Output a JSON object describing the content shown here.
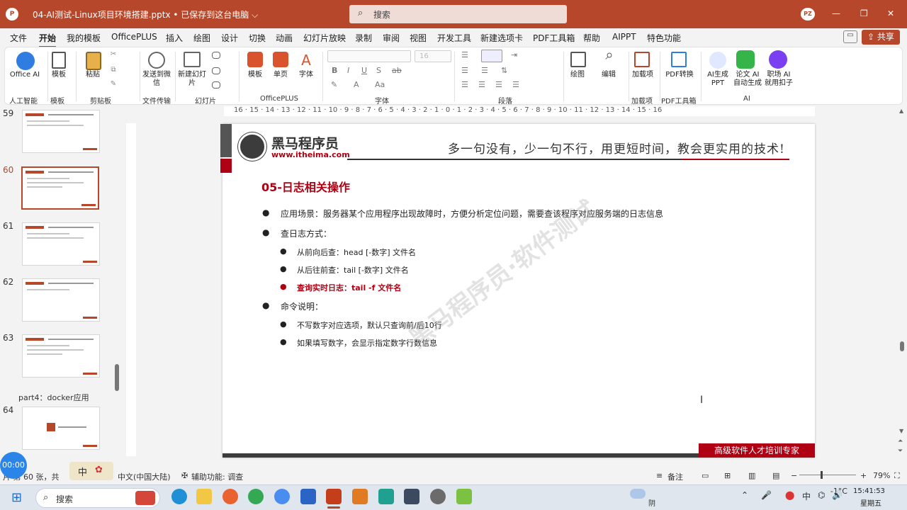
{
  "titlebar": {
    "app_icon": "P",
    "doc_title": "04-AI测试-Linux项目环境搭建.pptx  •  已保存到这台电脑 ⌵",
    "search_placeholder": "搜索",
    "avatar": "PZ"
  },
  "menu": {
    "items": [
      "文件",
      "开始",
      "我的模板",
      "OfficePLUS",
      "插入",
      "绘图",
      "设计",
      "切换",
      "动画",
      "幻灯片放映",
      "录制",
      "审阅",
      "视图",
      "开发工具",
      "新建选项卡",
      "PDF工具箱",
      "帮助",
      "AIPPT",
      "特色功能"
    ],
    "active": "开始",
    "share": "共享"
  },
  "ribbon": {
    "buttons": {
      "office_ai": "Office AI",
      "template": "模板",
      "paste": "粘贴",
      "send_wechat": "发送到微信",
      "new_slide": "新建幻灯片",
      "op_template": "模板",
      "single_page": "单页",
      "font_btn": "字体",
      "draw": "绘图",
      "edit": "编辑",
      "addin": "加载项",
      "pdf_convert": "PDF转换",
      "ai_ppt": "AI生成PPT",
      "thesis_ai": "论文 AI 自动生成",
      "job_ai": "职场 AI 就用扣子"
    },
    "groups": {
      "ai_smart": "人工智能",
      "template": "模板",
      "clipboard": "剪贴板",
      "file_transfer": "文件传输",
      "slides": "幻灯片",
      "officeplus": "OfficePLUS",
      "font": "字体",
      "paragraph": "段落",
      "addins": "加载项",
      "pdf_tools": "PDF工具箱",
      "ai": "AI"
    },
    "font_size_placeholder": "16"
  },
  "thumbnails": {
    "slides": [
      {
        "num": "59"
      },
      {
        "num": "60",
        "selected": true
      },
      {
        "num": "61"
      },
      {
        "num": "62"
      },
      {
        "num": "63"
      },
      {
        "num": "64"
      }
    ],
    "section": "part4：docker应用"
  },
  "ruler": {
    "ticks": "16 · 15 · 14 · 13 · 12 · 11 · 10 · 9 · 8 · 7 · 6 · 5 · 4 · 3 · 2 · 1 · 0 · 1 · 2 · 3 · 4 · 5 · 6 · 7 · 8 · 9 · 10 · 11 · 12 · 13 · 14 · 15 · 16"
  },
  "slide": {
    "logo_name": "黑马程序员",
    "logo_url": "www.itheima.com",
    "slogan": "多一句没有，少一句不行，用更短时间，教会更实用的技术!",
    "title": "05-日志相关操作",
    "bullets": [
      {
        "level": 1,
        "text": "应用场景：服务器某个应用程序出现故障时，方便分析定位问题，需要查该程序对应服务端的日志信息"
      },
      {
        "level": 1,
        "text": "查日志方式："
      },
      {
        "level": 2,
        "text": "从前向后查：head  [-数字] 文件名"
      },
      {
        "level": 2,
        "text": "从后往前查：tail [-数字] 文件名"
      },
      {
        "level": 2,
        "text": "查询实时日志：tail  -f 文件名",
        "highlight": true
      },
      {
        "level": 1,
        "text": "命令说明："
      },
      {
        "level": 2,
        "text": "不写数字对应选项，默认只查询前/后10行"
      },
      {
        "level": 2,
        "text": "如果填写数字，会显示指定数字行数信息"
      }
    ],
    "watermark": "黑马程序员·软件测试",
    "footer": "高级软件人才培训专家"
  },
  "status": {
    "slide_info": "片 第 60 张，共",
    "language": "中文(中国大陆)",
    "accessibility": "辅助功能: 调查",
    "notes": "备注",
    "zoom": "79%"
  },
  "float": {
    "timer": "00:00",
    "ime": "中"
  },
  "taskbar": {
    "search": "搜索",
    "weather_temp": "-1°C",
    "weather_desc": "阴",
    "time": "15:41:53",
    "day": "星期五"
  }
}
